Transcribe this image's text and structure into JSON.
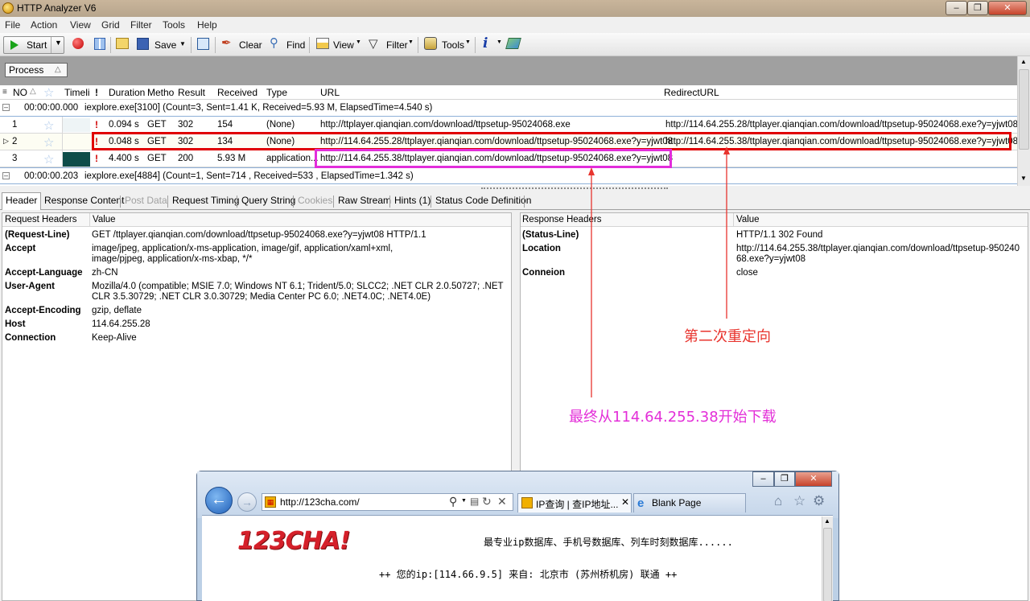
{
  "window": {
    "title": "HTTP Analyzer V6"
  },
  "menu": [
    "File",
    "Action",
    "View",
    "Grid",
    "Filter",
    "Tools",
    "Help"
  ],
  "toolbar": {
    "start": "Start",
    "save": "Save",
    "clear": "Clear",
    "find": "Find",
    "view": "View",
    "filter": "Filter",
    "tools": "Tools"
  },
  "group_by": "Process",
  "grid": {
    "columns": [
      "NO",
      "Timeli",
      "Duration",
      "Metho",
      "Result",
      "Received",
      "Type",
      "URL",
      "RedirectURL"
    ],
    "groups": [
      {
        "time": "00:00:00.000",
        "summary": "iexplore.exe[3100]  (Count=3, Sent=1.41 K, Received=5.93 M, ElapsedTime=4.540 s)"
      },
      {
        "time": "00:00:00.203",
        "summary": "iexplore.exe[4884]  (Count=1, Sent=714 , Received=533 , ElapsedTime=1.342 s)"
      }
    ],
    "rows": [
      {
        "no": "1",
        "duration": "0.094 s",
        "method": "GET",
        "result": "302",
        "received": "154",
        "type": "(None)",
        "url": "http://ttplayer.qianqian.com/download/ttpsetup-95024068.exe",
        "redirect": "http://114.64.255.28/ttplayer.qianqian.com/download/ttpsetup-95024068.exe?y=yjwt08"
      },
      {
        "no": "2",
        "duration": "0.048 s",
        "method": "GET",
        "result": "302",
        "received": "134",
        "type": "(None)",
        "url": "http://114.64.255.28/ttplayer.qianqian.com/download/ttpsetup-95024068.exe?y=yjwt08",
        "redirect": "http://114.64.255.38/ttplayer.qianqian.com/download/ttpsetup-95024068.exe?y=yjwt08"
      },
      {
        "no": "3",
        "duration": "4.400 s",
        "method": "GET",
        "result": "200",
        "received": "5.93 M",
        "type": "application...",
        "url": "http://114.64.255.38/ttplayer.qianqian.com/download/ttpsetup-95024068.exe?y=yjwt08",
        "redirect": ""
      }
    ]
  },
  "tabs": [
    "Header",
    "Response Content",
    "Post Data",
    "Request Timing",
    "Query String",
    "Cookies",
    "Raw Stream",
    "Hints (1)",
    "Status Code Definition"
  ],
  "request_headers": {
    "title": "Request Headers",
    "value_col": "Value",
    "items": [
      {
        "key": "(Request-Line)",
        "value": "GET /ttplayer.qianqian.com/download/ttpsetup-95024068.exe?y=yjwt08 HTTP/1.1"
      },
      {
        "key": "Accept",
        "value": "image/jpeg, application/x-ms-application, image/gif, application/xaml+xml, image/pjpeg, application/x-ms-xbap, */*"
      },
      {
        "key": "Accept-Language",
        "value": "zh-CN"
      },
      {
        "key": "User-Agent",
        "value": "Mozilla/4.0 (compatible; MSIE 7.0; Windows NT 6.1; Trident/5.0; SLCC2; .NET CLR 2.0.50727; .NET CLR 3.5.30729; .NET CLR 3.0.30729; Media Center PC 6.0; .NET4.0C; .NET4.0E)"
      },
      {
        "key": "Accept-Encoding",
        "value": "gzip, deflate"
      },
      {
        "key": "Host",
        "value": "114.64.255.28"
      },
      {
        "key": "Connection",
        "value": "Keep-Alive"
      }
    ]
  },
  "response_headers": {
    "title": "Response Headers",
    "value_col": "Value",
    "items": [
      {
        "key": "(Status-Line)",
        "value": "HTTP/1.1 302 Found"
      },
      {
        "key": "Location",
        "value": "http://114.64.255.38/ttplayer.qianqian.com/download/ttpsetup-95024068.exe?y=yjwt08"
      },
      {
        "key": "Conneion",
        "value": "close"
      }
    ]
  },
  "annotations": {
    "second_redirect": "第二次重定向",
    "final_download": "最终从114.64.255.38开始下载"
  },
  "browser": {
    "address": "http://123cha.com/",
    "tab1": "IP查询 | 查IP地址...",
    "tab2": "Blank Page",
    "logo": "123CHA!",
    "slogan": "最专业ip数据库、手机号数据库、列车时刻数据库......",
    "ip_line": "++ 您的ip:[114.66.9.5] 来自: 北京市 (苏州桥机房) 联通 ++"
  },
  "colors": {
    "red_box": "#e00000",
    "magenta_box": "#e22ddb"
  }
}
